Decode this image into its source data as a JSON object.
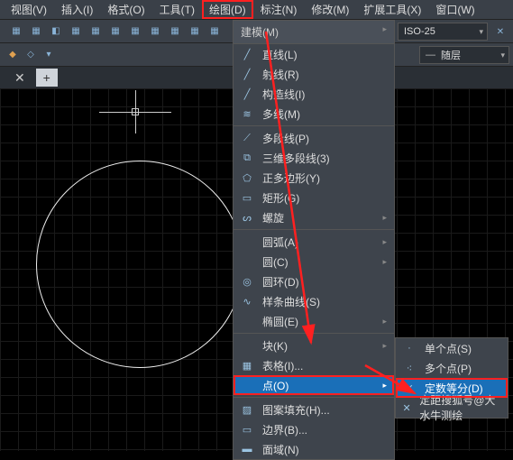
{
  "menubar": {
    "items": [
      "视图(V)",
      "插入(I)",
      "格式(O)",
      "工具(T)",
      "绘图(D)",
      "标注(N)",
      "修改(M)",
      "扩展工具(X)",
      "窗口(W)"
    ]
  },
  "toolbar_right": {
    "iso_label": "ISO-25",
    "layer_label": "随层"
  },
  "dropdown_menu": {
    "top_label": "建模(M)",
    "groups": [
      [
        {
          "icon": "╱",
          "label": "直线(L)"
        },
        {
          "icon": "╱",
          "label": "射线(R)"
        },
        {
          "icon": "╱",
          "label": "构造线(I)"
        },
        {
          "icon": "≋",
          "label": "多线(M)"
        }
      ],
      [
        {
          "icon": "⟋",
          "label": "多段线(P)"
        },
        {
          "icon": "⧉",
          "label": "三维多段线(3)"
        },
        {
          "icon": "⬠",
          "label": "正多边形(Y)"
        },
        {
          "icon": "▭",
          "label": "矩形(G)"
        },
        {
          "icon": "ᔕ",
          "label": "螺旋",
          "arrow": true
        }
      ],
      [
        {
          "icon": "",
          "label": "圆弧(A)",
          "arrow": true
        },
        {
          "icon": "",
          "label": "圆(C)",
          "arrow": true
        },
        {
          "icon": "◎",
          "label": "圆环(D)"
        },
        {
          "icon": "∿",
          "label": "样条曲线(S)"
        },
        {
          "icon": "",
          "label": "椭圆(E)",
          "arrow": true
        }
      ],
      [
        {
          "icon": "",
          "label": "块(K)",
          "arrow": true
        },
        {
          "icon": "▦",
          "label": "表格(I)..."
        },
        {
          "icon": "",
          "label": "点(O)",
          "arrow": true,
          "selected": true,
          "highlight": true
        }
      ],
      [
        {
          "icon": "▨",
          "label": "图案填充(H)..."
        },
        {
          "icon": "▭",
          "label": "边界(B)..."
        },
        {
          "icon": "▬",
          "label": "面域(N)"
        }
      ]
    ]
  },
  "submenu": {
    "items": [
      {
        "icon": "·",
        "label": "单个点(S)"
      },
      {
        "icon": "⁖",
        "label": "多个点(P)"
      },
      {
        "icon": "✕",
        "label": "定数等分(D)",
        "selected": true,
        "highlight": true
      },
      {
        "icon": "✕",
        "label": "定距搜狐号@大水牛测绘"
      }
    ]
  }
}
